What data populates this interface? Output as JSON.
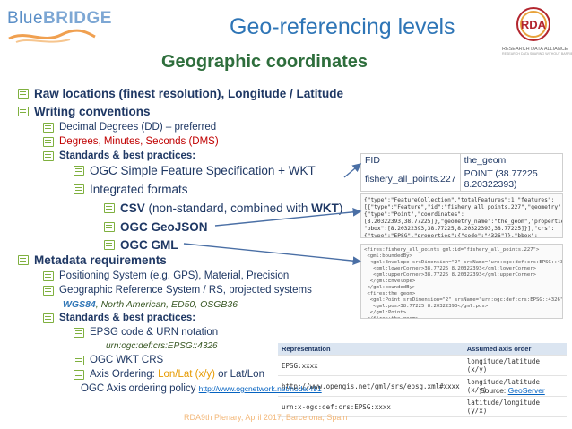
{
  "header": {
    "logo_prefix": "Blue",
    "logo_suffix": "BRIDGE",
    "title": "Geo-referencing levels",
    "subtitle": "Geographic coordinates",
    "rda_logo_label": "RDA",
    "rda_logo_caption": "RESEARCH DATA ALLIANCE",
    "rda_logo_tagline": "RESEARCH DATA SHARING WITHOUT BARRIERS"
  },
  "bullets": {
    "b1": "Raw locations (finest resolution), Longitude / Latitude",
    "b2": "Writing conventions",
    "b2_1": "Decimal Degrees (DD) – preferred",
    "b2_2": "Degrees, Minutes, Seconds (DMS)",
    "b2_3": "Standards & best practices:",
    "b2_3_1": "OGC Simple Feature Specification + WKT",
    "b2_3_2": "Integrated formats",
    "csv_bold": "CSV",
    "csv_rest": " (non-standard, combined with ",
    "csv_wkt": "WKT",
    "csv_close": ")",
    "geojson": "OGC GeoJSON",
    "gml": "OGC GML",
    "b3": "Metadata requirements",
    "b3_1": "Positioning System (e.g. GPS), Material, Precision",
    "b3_2": "Geographic Reference System / RS, projected systems",
    "b3_2_wgs": "WGS84",
    "b3_2_rest": ", North American, ED50, OSGB36",
    "b3_3": "Standards & best practices:",
    "b3_3_1": "EPSG code & URN notation",
    "urn_example": "urn:ogc:def:crs:EPSG::4326",
    "b3_3_2": "OGC WKT CRS",
    "b3_3_3_prefix": "Axis Ordering: ",
    "b3_3_3_lonlat": "Lon/Lat (x/y)",
    "b3_3_3_or": " or Lat/Lon",
    "b3_3_4": "OGC Axis ordering policy ",
    "b3_3_4_link": "http://www.ogcnetwork.net/node/491"
  },
  "fid_table": {
    "headers": [
      "FID",
      "the_geom"
    ],
    "row": [
      "fishery_all_points.227",
      "POINT (38.77225 8.20322393)"
    ]
  },
  "json_snippet": "{\"type\":\"FeatureCollection\",\"totalFeatures\":1,\"features\":\n[{\"type\":\"Feature\",\"id\":\"fishery_all_points.227\",\"geometry\":\n{\"type\":\"Point\",\"coordinates\":\n[8.20322393,38.77225]},\"geometry_name\":\"the_geom\",\"properties\":\n\"bbox\":[8.20322393,38.77225,8.20322393,38.77225]}],\"crs\":\n{\"type\":\"EPSG\",\"properties\":{\"code\":\"4326\"}},\"bbox\":\n[8.77225,8.20322393,38.77225,8.20322393]}",
  "gml_snippet": "<fires:fishery_all_points gml:id=\"fishery_all_points.227\">\n <gml:boundedBy>\n  <gml:Envelope srsDimension=\"2\" srsName=\"urn:ogc:def:crs:EPSG::4326\">\n   <gml:lowerCorner>38.77225 8.20322393</gml:lowerCorner>\n   <gml:upperCorner>38.77225 8.20322393</gml:upperCorner>\n  </gml:Envelope>\n </gml:boundedBy>\n <fires:the_geom>\n  <gml:Point srsDimension=\"2\" srsName=\"urn:ogc:def:crs:EPSG::4326\">\n   <gml:pos>38.77225 8.20322393</gml:pos>\n  </gml:Point>\n </fires:the_geom>\n</fires:fishery_all_points>",
  "axis_table": {
    "headers": [
      "Representation",
      "Assumed axis order"
    ],
    "rows": [
      [
        "EPSG:xxxx",
        "longitude/latitude (x/y)"
      ],
      [
        "http://www.opengis.net/gml/srs/epsg.xml#xxxx",
        "longitude/latitude (x/y)"
      ],
      [
        "urn:x-ogc:def:crs:EPSG:xxxx",
        "latitude/longitude (y/x)"
      ]
    ]
  },
  "source_label": "Source: ",
  "source_link": "GeoServer",
  "footer": "RDA9th Plenary, April 2017, Barcelona, Spain",
  "colors": {
    "title": "#2e75b6",
    "subtitle": "#2e6e3c",
    "text": "#1f3864",
    "red": "#c00000",
    "orange": "#e69a00",
    "bullet_green": "#7fb03f",
    "arrow": "#4a6fa5",
    "footer": "#f3b87a"
  }
}
